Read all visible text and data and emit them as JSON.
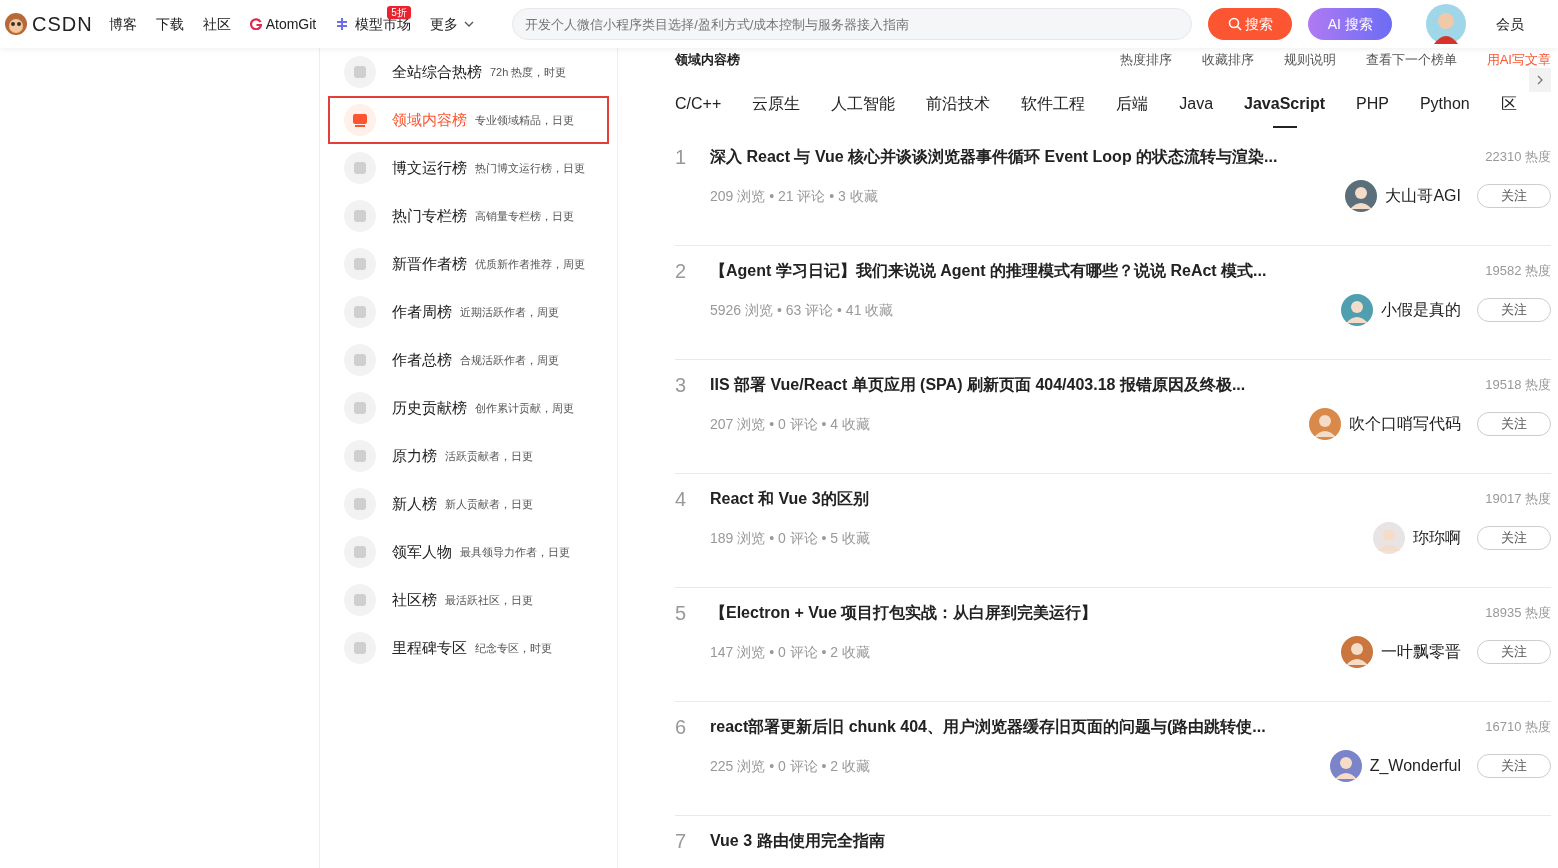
{
  "header": {
    "logo": "CSDN",
    "nav": [
      {
        "label": "博客",
        "kind": "text"
      },
      {
        "label": "下载",
        "kind": "text"
      },
      {
        "label": "社区",
        "kind": "text"
      },
      {
        "label": "AtomGit",
        "kind": "logo"
      },
      {
        "label": "模型市场",
        "kind": "model",
        "badge": "5折"
      },
      {
        "label": "更多",
        "kind": "menu"
      }
    ],
    "search": {
      "placeholder": "开发个人微信小程序类目选择/盈利方式/成本控制与服务器接入指南"
    },
    "search_button": "搜索",
    "ai_button": "AI 搜索",
    "member": "会员"
  },
  "sidebar": {
    "items": [
      {
        "title": "全站综合热榜",
        "desc": "72h 热度，时更",
        "selected": false
      },
      {
        "title": "领域内容榜",
        "desc": "专业领域精品，日更",
        "selected": true
      },
      {
        "title": "博文运行榜",
        "desc": "热门博文运行榜，日更",
        "selected": false
      },
      {
        "title": "热门专栏榜",
        "desc": "高销量专栏榜，日更",
        "selected": false
      },
      {
        "title": "新晋作者榜",
        "desc": "优质新作者推荐，周更",
        "selected": false
      },
      {
        "title": "作者周榜",
        "desc": "近期活跃作者，周更",
        "selected": false
      },
      {
        "title": "作者总榜",
        "desc": "合规活跃作者，周更",
        "selected": false
      },
      {
        "title": "历史贡献榜",
        "desc": "创作累计贡献，周更",
        "selected": false
      },
      {
        "title": "原力榜",
        "desc": "活跃贡献者，日更",
        "selected": false
      },
      {
        "title": "新人榜",
        "desc": "新人贡献者，日更",
        "selected": false
      },
      {
        "title": "领军人物",
        "desc": "最具领导力作者，日更",
        "selected": false
      },
      {
        "title": "社区榜",
        "desc": "最活跃社区，日更",
        "selected": false
      },
      {
        "title": "里程碑专区",
        "desc": "纪念专区，时更",
        "selected": false
      }
    ]
  },
  "board": {
    "title": "领域内容榜",
    "links": [
      "热度排序",
      "收藏排序",
      "规则说明",
      "查看下一个榜单",
      "用AI写文章"
    ]
  },
  "tabs": [
    {
      "label": "C/C++",
      "selected": false
    },
    {
      "label": "云原生",
      "selected": false
    },
    {
      "label": "人工智能",
      "selected": false
    },
    {
      "label": "前沿技术",
      "selected": false
    },
    {
      "label": "软件工程",
      "selected": false
    },
    {
      "label": "后端",
      "selected": false
    },
    {
      "label": "Java",
      "selected": false
    },
    {
      "label": "JavaScript",
      "selected": true
    },
    {
      "label": "PHP",
      "selected": false
    },
    {
      "label": "Python",
      "selected": false
    },
    {
      "label": "区",
      "selected": false
    }
  ],
  "articles": [
    {
      "rank": "1",
      "title": "深入 React 与 Vue 核心并谈谈浏览器事件循环 Event Loop 的状态流转与渲染...",
      "heat": "22310 热度",
      "stats": "209 浏览 • 21 评论 • 3 收藏",
      "author": "大山哥AGI",
      "follow": "关注",
      "color": "#5a6f7a"
    },
    {
      "rank": "2",
      "title": "【Agent 学习日记】我们来说说 Agent 的推理模式有哪些？说说 ReAct 模式...",
      "heat": "19582 热度",
      "stats": "5926 浏览 • 63 评论 • 41 收藏",
      "author": "小假是真的",
      "follow": "关注",
      "color": "#4f9fb0"
    },
    {
      "rank": "3",
      "title": "IIS 部署 Vue/React 单页应用 (SPA) 刷新页面 404/403.18 报错原因及终极...",
      "heat": "19518 热度",
      "stats": "207 浏览 • 0 评论 • 4 收藏",
      "author": "吹个口哨写代码",
      "follow": "关注",
      "color": "#d98a4a"
    },
    {
      "rank": "4",
      "title": "React 和 Vue 3的区别",
      "heat": "19017 热度",
      "stats": "189 浏览 • 0 评论 • 5 收藏",
      "author": "珎珎啊",
      "follow": "关注",
      "color": "#e9e4e4"
    },
    {
      "rank": "5",
      "title": "【Electron + Vue 项目打包实战：从白屏到完美运行】",
      "heat": "18935 热度",
      "stats": "147 浏览 • 0 评论 • 2 收藏",
      "author": "一叶飘零晋",
      "follow": "关注",
      "color": "#c9773f"
    },
    {
      "rank": "6",
      "title": "react部署更新后旧 chunk 404、用户浏览器缓存旧页面的问题与(路由跳转使...",
      "heat": "16710 热度",
      "stats": "225 浏览 • 0 评论 • 2 收藏",
      "author": "Z_Wonderful",
      "follow": "关注",
      "color": "#7b83c9"
    },
    {
      "rank": "7",
      "title": "Vue 3 路由使用完全指南"
    }
  ]
}
